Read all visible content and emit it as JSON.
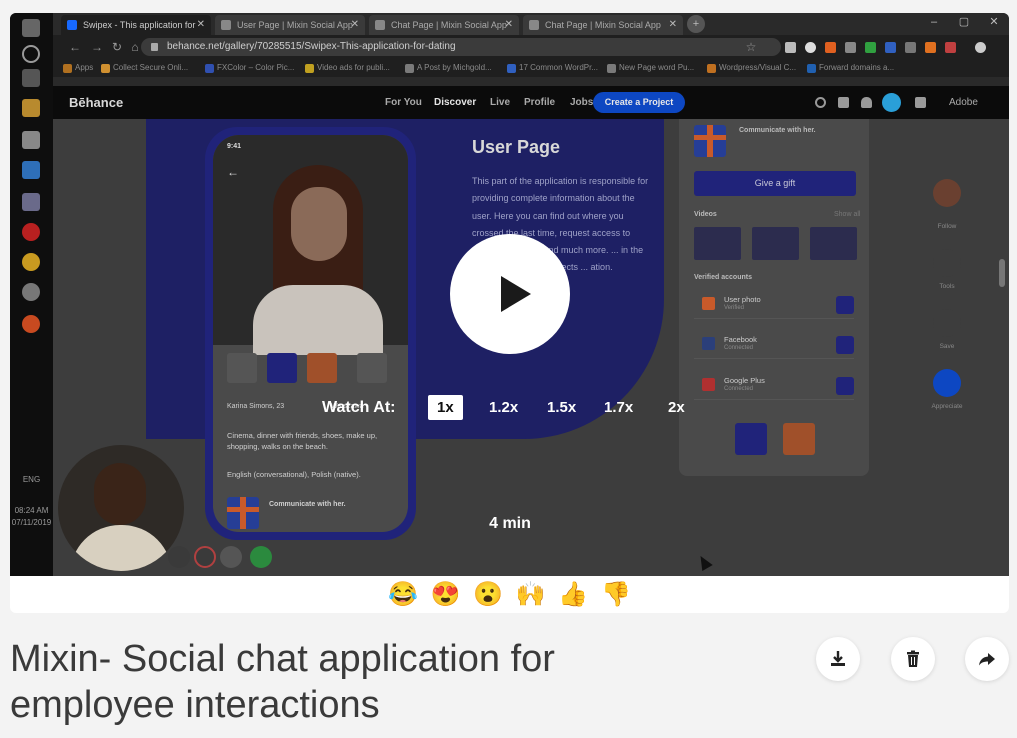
{
  "browser": {
    "tabs": [
      {
        "label": "Swipex - This application for",
        "active": true
      },
      {
        "label": "User Page | Mixin Social App"
      },
      {
        "label": "Chat Page | Mixin Social App"
      },
      {
        "label": "Chat Page | Mixin Social App"
      }
    ],
    "new_tab": "+",
    "url": "behance.net/gallery/70285515/Swipex-This-application-for-dating",
    "bookmarks": [
      "Apps",
      "Collect Secure Onli...",
      "FXColor – Color Pic...",
      "Video ads for publi...",
      "A Post by Michgold...",
      "17 Common WordPr...",
      "New Page word Pu...",
      "Wordpress/Visual C...",
      "Forward domains a..."
    ],
    "window_controls": [
      "–",
      "▢",
      "✕"
    ]
  },
  "taskbar": {
    "lang": "ENG",
    "time": "08:24 AM",
    "date": "07/11/2019"
  },
  "behance": {
    "logo": "Bēhance",
    "nav": [
      "For You",
      "Discover",
      "Live",
      "Profile",
      "Jobs"
    ],
    "cta": "Create a Project",
    "adobe": "Adobe"
  },
  "project": {
    "title": "User Page",
    "description": "This part of the application is responsible for providing complete information about the user. Here you can find out where you crossed the last time, request access to other ... networks and much more. ... in the user, he ... the user rejects ... ation.",
    "phone_time": "9:41",
    "profile_name": "Karina Simons, 23",
    "location": "Warszawa",
    "interests": "Cinema, dinner with friends, shoes, make up, shopping, walks on the beach.",
    "languages": "English (conversational), Polish (native).",
    "communicate_title": "Communicate with her.",
    "communicate_top": "Communicate with her.",
    "give_gift": "Give a gift",
    "videos_label": "Videos",
    "videos_show": "Show all",
    "verified_label": "Verified accounts",
    "accounts": [
      {
        "name": "User photo",
        "sub": "Verified",
        "color": "#c85a2a"
      },
      {
        "name": "Facebook",
        "sub": "Connected",
        "color": "#2b3f7a"
      },
      {
        "name": "Google Plus",
        "sub": "Connected",
        "color": "#b03030"
      }
    ],
    "side": [
      "Follow",
      "Tools",
      "Save",
      "Appreciate"
    ]
  },
  "player": {
    "watch_label": "Watch At:",
    "speeds": [
      "1x",
      "1.2x",
      "1.5x",
      "1.7x",
      "2x"
    ],
    "selected_speed": "1x",
    "duration": "4 min"
  },
  "reactions": [
    "😂",
    "😍",
    "😮",
    "🙌",
    "👍",
    "👎"
  ],
  "video_title": "Mixin- Social chat application for employee interactions",
  "actions": [
    {
      "name": "download-icon"
    },
    {
      "name": "trash-icon"
    },
    {
      "name": "share-icon"
    }
  ]
}
